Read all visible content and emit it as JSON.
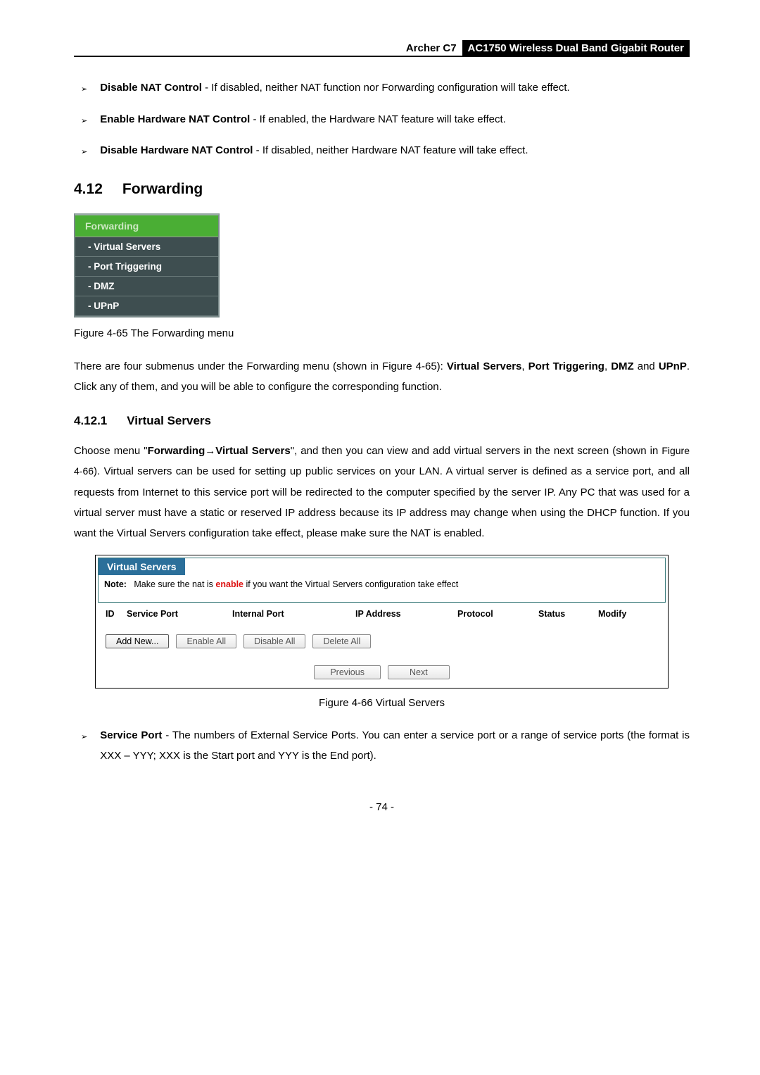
{
  "header": {
    "model": "Archer C7",
    "product": "AC1750 Wireless Dual Band Gigabit Router"
  },
  "bullets_top": [
    {
      "strong": "Disable NAT Control",
      "rest": " - If disabled, neither NAT function nor Forwarding configuration will take effect."
    },
    {
      "strong": "Enable Hardware NAT Control",
      "rest": " - If enabled, the Hardware NAT feature will take effect."
    },
    {
      "strong": "Disable Hardware NAT Control",
      "rest": " - If disabled, neither Hardware NAT feature will take effect."
    }
  ],
  "section": {
    "num": "4.12",
    "title": "Forwarding"
  },
  "menu": {
    "header": "Forwarding",
    "items": [
      "- Virtual Servers",
      "- Port Triggering",
      "- DMZ",
      "- UPnP"
    ]
  },
  "fig65_caption": "Figure 4-65 The Forwarding menu",
  "para_after_menu": {
    "pre": "There are four submenus under the Forwarding menu (shown in Figure 4-65): ",
    "b1": "Virtual Servers",
    "c1": ", ",
    "b2": "Port Triggering",
    "c2": ", ",
    "b3": "DMZ",
    "c3": " and ",
    "b4": "UPnP",
    "post": ". Click any of them, and you will be able to configure the corresponding function."
  },
  "subsection": {
    "num": "4.12.1",
    "title": "Virtual Servers"
  },
  "para_vs": {
    "pre": "Choose menu \"",
    "b1": "Forwarding",
    "arrow": "→",
    "b2": "Virtual Servers",
    "mid": "\", and then you can view and add virtual servers in the next screen (shown in ",
    "figref": "Figure 4-66",
    "post": "). Virtual servers can be used for setting up public services on your LAN. A virtual server is defined as a service port, and all requests from Internet to this service port will be redirected to the computer specified by the server IP. Any PC that was used for a virtual server must have a static or reserved IP address because its IP address may change when using the DHCP function. If you want the Virtual Servers configuration take effect, please make sure the NAT is enabled."
  },
  "vs_figure": {
    "title": "Virtual Servers",
    "note_label": "Note:",
    "note_pre": "Make sure the nat is ",
    "note_enable": "enable",
    "note_post": " if you want the Virtual Servers configuration take effect",
    "headers": {
      "id": "ID",
      "service_port": "Service Port",
      "internal_port": "Internal Port",
      "ip_address": "IP Address",
      "protocol": "Protocol",
      "status": "Status",
      "modify": "Modify"
    },
    "buttons": {
      "add_new": "Add New...",
      "enable_all": "Enable All",
      "disable_all": "Disable All",
      "delete_all": "Delete All",
      "previous": "Previous",
      "next": "Next"
    }
  },
  "fig66_caption": "Figure 4-66 Virtual Servers",
  "bullets_bottom": [
    {
      "strong": "Service Port",
      "rest": " - The numbers of External Service Ports. You can enter a service port or a range of service ports (the format is XXX – YYY; XXX is the Start port and YYY is the End port)."
    }
  ],
  "page_number": "- 74 -"
}
